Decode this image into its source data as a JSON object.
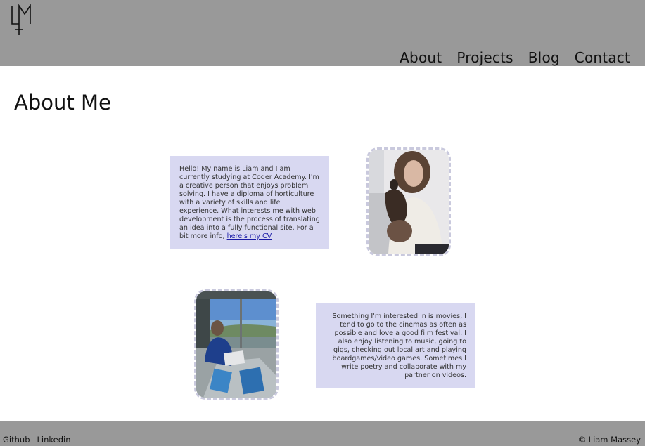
{
  "header": {
    "logo_icon": "lm-monogram-logo",
    "nav": [
      {
        "label": "About"
      },
      {
        "label": "Projects"
      },
      {
        "label": "Blog"
      },
      {
        "label": "Contact"
      }
    ]
  },
  "main": {
    "title": "About Me",
    "bio_1": {
      "text": "Hello! My name is Liam and I am currently studying at Coder Academy. I'm a creative person that enjoys problem solving. I have a diploma of horticulture with a variety of skills and life experience. What interests me with web development is the process of translating an idea into a fully functional site. For a bit more info, ",
      "link_label": "here's my CV"
    },
    "bio_2": {
      "text": "Something I'm interested in is movies, I tend to go to the cinemas as often as possible and love a good film festival. I also enjoy listening to music, going to gigs, checking out local art and playing boardgames/video games. Sometimes I write poetry and collaborate with my partner on videos."
    }
  },
  "footer": {
    "links": [
      {
        "label": "Github"
      },
      {
        "label": "Linkedin"
      }
    ],
    "copyright": "© Liam Massey"
  },
  "colors": {
    "header_bg": "#999999",
    "footer_bg": "#999999",
    "bio_bg": "#d8d8f1",
    "photo_border": "#c9c9dd",
    "link": "#1a1aa6"
  }
}
